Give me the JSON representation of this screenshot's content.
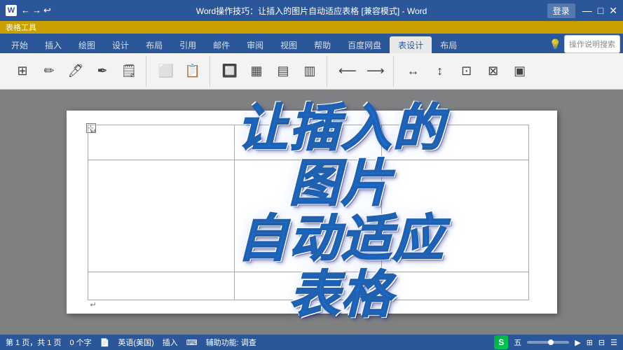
{
  "titlebar": {
    "title": "Word操作技巧：让插入的图片自动适应表格 [兼容模式] - Word",
    "app_name": "Word",
    "login_label": "登录",
    "back_arrow": "←",
    "forward_arrow": "→",
    "undo_arrow": "↩"
  },
  "extra_tab": {
    "label": "表格工具"
  },
  "tabs": [
    {
      "id": "home",
      "label": "开始"
    },
    {
      "id": "insert",
      "label": "插入"
    },
    {
      "id": "draw",
      "label": "绘图"
    },
    {
      "id": "design",
      "label": "设计"
    },
    {
      "id": "layout",
      "label": "布局"
    },
    {
      "id": "references",
      "label": "引用",
      "active": true
    },
    {
      "id": "mail",
      "label": "邮件"
    },
    {
      "id": "review",
      "label": "审阅"
    },
    {
      "id": "view",
      "label": "视图"
    },
    {
      "id": "help",
      "label": "帮助"
    },
    {
      "id": "baidu",
      "label": "百度网盘"
    }
  ],
  "ribbon_tabs": [
    {
      "id": "table-design",
      "label": "表设计"
    },
    {
      "id": "table-layout",
      "label": "布局"
    }
  ],
  "toolbar": {
    "search_placeholder": "操作说明搜索",
    "groups": [
      {
        "id": "text",
        "buttons": [
          {
            "id": "bold",
            "icon": "B",
            "label": ""
          },
          {
            "id": "font-size",
            "icon": "A",
            "label": ""
          }
        ]
      }
    ]
  },
  "document": {
    "big_title_lines": [
      "让插入的",
      "图片",
      "自动适应",
      "表格"
    ],
    "table_rows": 3,
    "table_cols": 3
  },
  "statusbar": {
    "pages": "第 1 页，共 1 页",
    "words": "0 个字",
    "doc_icon": "📄",
    "language": "英语(美国)",
    "insert": "插入",
    "keyboard_icon": "⌨",
    "accessibility": "辅助功能: 调查",
    "zoom": "五",
    "zoom_percent": "▶",
    "window_btns": "五▶▲"
  },
  "window_controls": {
    "minimize": "—",
    "maximize": "□",
    "close": "✕"
  }
}
